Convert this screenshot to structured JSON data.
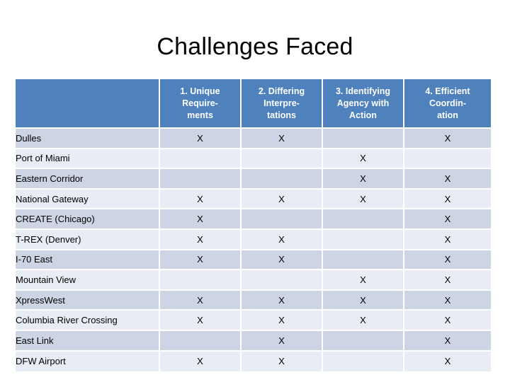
{
  "slide": {
    "title": "Challenges Faced"
  },
  "colors": {
    "header_fill": "#4F81BD",
    "header_text": "#FFFFFF",
    "band_dark": "#CDD4E4",
    "band_light": "#E8ECF4",
    "body_text": "#000000",
    "page_background": "#FFFFFF"
  },
  "table": {
    "mark_symbol": "X",
    "headers": [
      "",
      "1. Unique Require-ments",
      "2. Differing Interpre-tations",
      "3. Identifying Agency with Action",
      "4. Efficient Coordin-ation"
    ],
    "headers_lines": [
      [
        ""
      ],
      [
        "1. Unique",
        "Require-",
        "ments"
      ],
      [
        "2. Differing",
        "Interpre-",
        "tations"
      ],
      [
        "3. Identifying",
        "Agency with",
        "Action"
      ],
      [
        "4. Efficient",
        "Coordin-",
        "ation"
      ]
    ],
    "rows": [
      {
        "label": "Dulles",
        "cells": [
          "X",
          "X",
          "",
          "X"
        ]
      },
      {
        "label": "Port of Miami",
        "cells": [
          "",
          "",
          "X",
          ""
        ]
      },
      {
        "label": "Eastern Corridor",
        "cells": [
          "",
          "",
          "X",
          "X"
        ]
      },
      {
        "label": "National Gateway",
        "cells": [
          "X",
          "X",
          "X",
          "X"
        ]
      },
      {
        "label": "CREATE (Chicago)",
        "cells": [
          "X",
          "",
          "",
          "X"
        ]
      },
      {
        "label": "T-REX (Denver)",
        "cells": [
          "X",
          "X",
          "",
          "X"
        ]
      },
      {
        "label": "I-70 East",
        "cells": [
          "X",
          "X",
          "",
          "X"
        ]
      },
      {
        "label": "Mountain View",
        "cells": [
          "",
          "",
          "X",
          "X"
        ]
      },
      {
        "label": "XpressWest",
        "cells": [
          "X",
          "X",
          "X",
          "X"
        ]
      },
      {
        "label": "Columbia River Crossing",
        "cells": [
          "X",
          "X",
          "X",
          "X"
        ]
      },
      {
        "label": "East Link",
        "cells": [
          "",
          "X",
          "",
          "X"
        ]
      },
      {
        "label": "DFW Airport",
        "cells": [
          "X",
          "X",
          "",
          "X"
        ]
      }
    ]
  }
}
